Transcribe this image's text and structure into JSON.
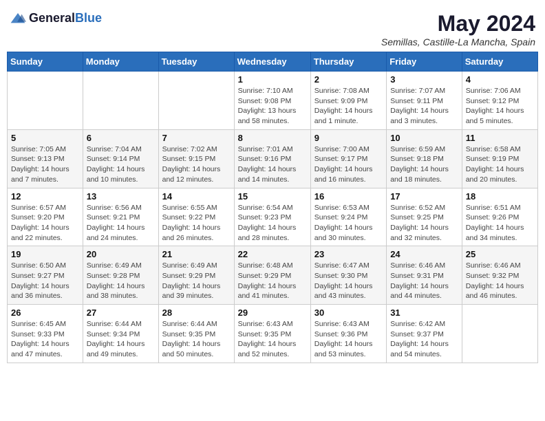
{
  "header": {
    "logo_general": "General",
    "logo_blue": "Blue",
    "title": "May 2024",
    "location": "Semillas, Castille-La Mancha, Spain"
  },
  "weekdays": [
    "Sunday",
    "Monday",
    "Tuesday",
    "Wednesday",
    "Thursday",
    "Friday",
    "Saturday"
  ],
  "weeks": [
    [
      {
        "day": "",
        "info": ""
      },
      {
        "day": "",
        "info": ""
      },
      {
        "day": "",
        "info": ""
      },
      {
        "day": "1",
        "info": "Sunrise: 7:10 AM\nSunset: 9:08 PM\nDaylight: 13 hours\nand 58 minutes."
      },
      {
        "day": "2",
        "info": "Sunrise: 7:08 AM\nSunset: 9:09 PM\nDaylight: 14 hours\nand 1 minute."
      },
      {
        "day": "3",
        "info": "Sunrise: 7:07 AM\nSunset: 9:11 PM\nDaylight: 14 hours\nand 3 minutes."
      },
      {
        "day": "4",
        "info": "Sunrise: 7:06 AM\nSunset: 9:12 PM\nDaylight: 14 hours\nand 5 minutes."
      }
    ],
    [
      {
        "day": "5",
        "info": "Sunrise: 7:05 AM\nSunset: 9:13 PM\nDaylight: 14 hours\nand 7 minutes."
      },
      {
        "day": "6",
        "info": "Sunrise: 7:04 AM\nSunset: 9:14 PM\nDaylight: 14 hours\nand 10 minutes."
      },
      {
        "day": "7",
        "info": "Sunrise: 7:02 AM\nSunset: 9:15 PM\nDaylight: 14 hours\nand 12 minutes."
      },
      {
        "day": "8",
        "info": "Sunrise: 7:01 AM\nSunset: 9:16 PM\nDaylight: 14 hours\nand 14 minutes."
      },
      {
        "day": "9",
        "info": "Sunrise: 7:00 AM\nSunset: 9:17 PM\nDaylight: 14 hours\nand 16 minutes."
      },
      {
        "day": "10",
        "info": "Sunrise: 6:59 AM\nSunset: 9:18 PM\nDaylight: 14 hours\nand 18 minutes."
      },
      {
        "day": "11",
        "info": "Sunrise: 6:58 AM\nSunset: 9:19 PM\nDaylight: 14 hours\nand 20 minutes."
      }
    ],
    [
      {
        "day": "12",
        "info": "Sunrise: 6:57 AM\nSunset: 9:20 PM\nDaylight: 14 hours\nand 22 minutes."
      },
      {
        "day": "13",
        "info": "Sunrise: 6:56 AM\nSunset: 9:21 PM\nDaylight: 14 hours\nand 24 minutes."
      },
      {
        "day": "14",
        "info": "Sunrise: 6:55 AM\nSunset: 9:22 PM\nDaylight: 14 hours\nand 26 minutes."
      },
      {
        "day": "15",
        "info": "Sunrise: 6:54 AM\nSunset: 9:23 PM\nDaylight: 14 hours\nand 28 minutes."
      },
      {
        "day": "16",
        "info": "Sunrise: 6:53 AM\nSunset: 9:24 PM\nDaylight: 14 hours\nand 30 minutes."
      },
      {
        "day": "17",
        "info": "Sunrise: 6:52 AM\nSunset: 9:25 PM\nDaylight: 14 hours\nand 32 minutes."
      },
      {
        "day": "18",
        "info": "Sunrise: 6:51 AM\nSunset: 9:26 PM\nDaylight: 14 hours\nand 34 minutes."
      }
    ],
    [
      {
        "day": "19",
        "info": "Sunrise: 6:50 AM\nSunset: 9:27 PM\nDaylight: 14 hours\nand 36 minutes."
      },
      {
        "day": "20",
        "info": "Sunrise: 6:49 AM\nSunset: 9:28 PM\nDaylight: 14 hours\nand 38 minutes."
      },
      {
        "day": "21",
        "info": "Sunrise: 6:49 AM\nSunset: 9:29 PM\nDaylight: 14 hours\nand 39 minutes."
      },
      {
        "day": "22",
        "info": "Sunrise: 6:48 AM\nSunset: 9:29 PM\nDaylight: 14 hours\nand 41 minutes."
      },
      {
        "day": "23",
        "info": "Sunrise: 6:47 AM\nSunset: 9:30 PM\nDaylight: 14 hours\nand 43 minutes."
      },
      {
        "day": "24",
        "info": "Sunrise: 6:46 AM\nSunset: 9:31 PM\nDaylight: 14 hours\nand 44 minutes."
      },
      {
        "day": "25",
        "info": "Sunrise: 6:46 AM\nSunset: 9:32 PM\nDaylight: 14 hours\nand 46 minutes."
      }
    ],
    [
      {
        "day": "26",
        "info": "Sunrise: 6:45 AM\nSunset: 9:33 PM\nDaylight: 14 hours\nand 47 minutes."
      },
      {
        "day": "27",
        "info": "Sunrise: 6:44 AM\nSunset: 9:34 PM\nDaylight: 14 hours\nand 49 minutes."
      },
      {
        "day": "28",
        "info": "Sunrise: 6:44 AM\nSunset: 9:35 PM\nDaylight: 14 hours\nand 50 minutes."
      },
      {
        "day": "29",
        "info": "Sunrise: 6:43 AM\nSunset: 9:35 PM\nDaylight: 14 hours\nand 52 minutes."
      },
      {
        "day": "30",
        "info": "Sunrise: 6:43 AM\nSunset: 9:36 PM\nDaylight: 14 hours\nand 53 minutes."
      },
      {
        "day": "31",
        "info": "Sunrise: 6:42 AM\nSunset: 9:37 PM\nDaylight: 14 hours\nand 54 minutes."
      },
      {
        "day": "",
        "info": ""
      }
    ]
  ]
}
